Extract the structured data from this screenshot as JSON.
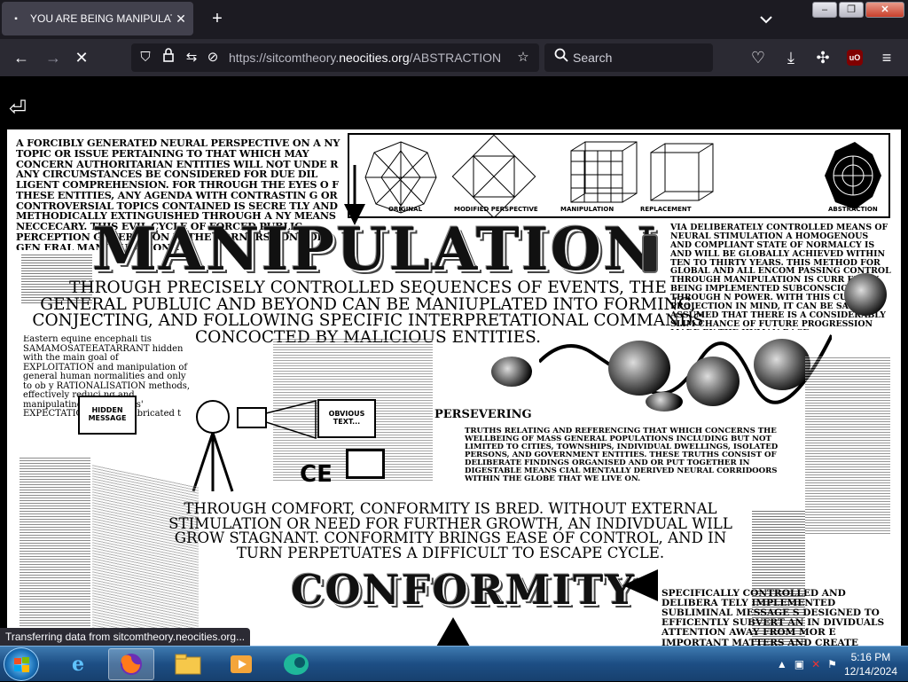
{
  "browser": {
    "tab": {
      "title": "YOU ARE BEING MANIPULATED",
      "favicon": "page-icon"
    },
    "url_prefix": "https://sitcomtheory.",
    "url_domain": "neocities.org",
    "url_suffix": "/ABSTRACTION",
    "search_placeholder": "Search",
    "status_text": "Transferring data from sitcomtheory.neocities.org...",
    "icons": [
      "back-icon",
      "forward-icon",
      "stop-icon",
      "shield-icon",
      "lock-icon",
      "permissions-icon",
      "tracking-icon",
      "bookmark-star-icon",
      "search-icon",
      "pocket-icon",
      "download-icon",
      "extensions-icon",
      "ublock-icon",
      "menu-icon"
    ]
  },
  "artwork": {
    "intro_paragraph": "A FORCIBLY GENERATED NEURAL PERSPECTIVE ON A NY TOPIC OR ISSUE PERTAINING TO THAT WHICH MAY CONCERN AUTHORITARIAN ENTITIES WILL NOT UNDE R ANY CIRCUMSTANCES BE CONSIDERED FOR DUE DIL LIGENT COMPREHENSION. FOR THROUGH THE EYES O F THESE ENTITIES, ANY AGENDA WITH CONTRASTIN G OR CONTROVERSIAL TOPICS CONTAINED IS SECRE TLY AND METHODICALLY EXTINGUISHED THROUGH A NY MEANS NECCECARY. THIS EVIL CYCLE OF FORCED PUBLIC PERCEPTION GENERATION IS THE CORNERST ONE OF GEN ERAL MANI PULATION...",
    "title_manipulation": "MANIPULATION",
    "subtitle_1": "THROUGH PRECISELY CONTROLLED SEQUENCES OF EVENTS, THE GENERAL PUBLUIC AND BEYOND CAN BE MANIUPLATED INTO FORMING, CONJECTING, AND FOLLOWING SPECIFIC INTERPRETATIONAL COMMANDS CONCOCTED BY MALICIOUS ENTITIES.",
    "diagram_labels": [
      "ORIGINAL",
      "MODIFIED PERSPECTIVE",
      "MANIPULATION",
      "REPLACEMENT",
      "ABSTRACTION"
    ],
    "right_paragraph": "VIA DELIBERATELY CONTROLLED MEANS OF NEURAL STIMULATION A HOMOGENOUS AND COMPLIANT STATE OF NORMALCY IS AND WILL BE GLOBALLY ACHIEVED WITHIN TEN TO THIRTY YEARS. THIS METHOD FOR GLOBAL AND ALL ENCOM PASSING CONTROL THROUGH MANIPULATION IS CURR ENTLY BEING IMPLEMENTED SUBCONSCIOUSLY THROUGH N POWER. WITH THIS CURRENT PROJECTION IN MIND, IT CAN BE SAFELY ASSUMED THAT THERE IS A CONSIDERABLY SLIM CHANCE OF FUTURE PROGRESSION MADE BY THE HUMAN RACE",
    "left_column": "Eastern equine encephali tis SAMAMOSATEEATARRANT hidden with the main goal of EXPLOITATION and manipulation of general human normalities and only to ob y RATIONALISATION methods, effectively reduci ng and manipulating the pers ons' EXPECTATIONS of the fabricated t",
    "box_hidden": "HIDDEN MESSAGE",
    "box_obvious": "OBVIOUS TEXT...",
    "persevering": "PERSEVERING",
    "persevering_text": "TRUTHS RELATING AND REFERENCING THAT WHICH CONCERNS THE WELLBEING OF MASS GENERAL POPULATIONS INCLUDING BUT NOT LIMITED TO CITIES, TOWNSHIPS, INDIVIDUAL DWELLINGS, ISOLATED PERSONS, AND GOVERNMENT ENTITIES. THESE TRUTHS CONSIST OF DELIBERATE FINDINGS ORGANISED AND OR PUT TOGETHER IN DIGESTABLE MEANS CIAL MENTALLY DERIVED NEURAL CORRIDOORS WITHIN THE GLOBE THAT WE LIVE ON.",
    "subtitle_2": "THROUGH COMFORT, CONFORMITY IS BRED. WITHOUT EXTERNAL STIMULATION OR NEED FOR FURTHER GROWTH, AN INDIVDUAL WILL GROW STAGNANT. CONFORMITY BRINGS EASE OF CONTROL, AND IN TURN PERPETUATES A DIFFICULT TO ESCAPE CYCLE.",
    "title_conformity": "CONFORMITY",
    "bottom_right": "SPECIFICALLY CONTROLLED AND DELIBERA TELY IMPLEMENTED SUBLIMINAL MESSAGE S DESIGNED TO EFFICENTLY SUBVERT AN IN DIVIDUALS ATTENTION AWAY FROM MOR E IMPORTANT MATTERS AND CREATE DIVISION S BETWEEN MEANINGFUL INFORMATION, A",
    "ce_mark": "CE"
  },
  "taskbar": {
    "apps": [
      "start-orb",
      "internet-explorer-icon",
      "firefox-icon",
      "file-explorer-icon",
      "media-player-icon",
      "app-icon"
    ],
    "time": "5:16 PM",
    "date": "12/14/2024"
  }
}
